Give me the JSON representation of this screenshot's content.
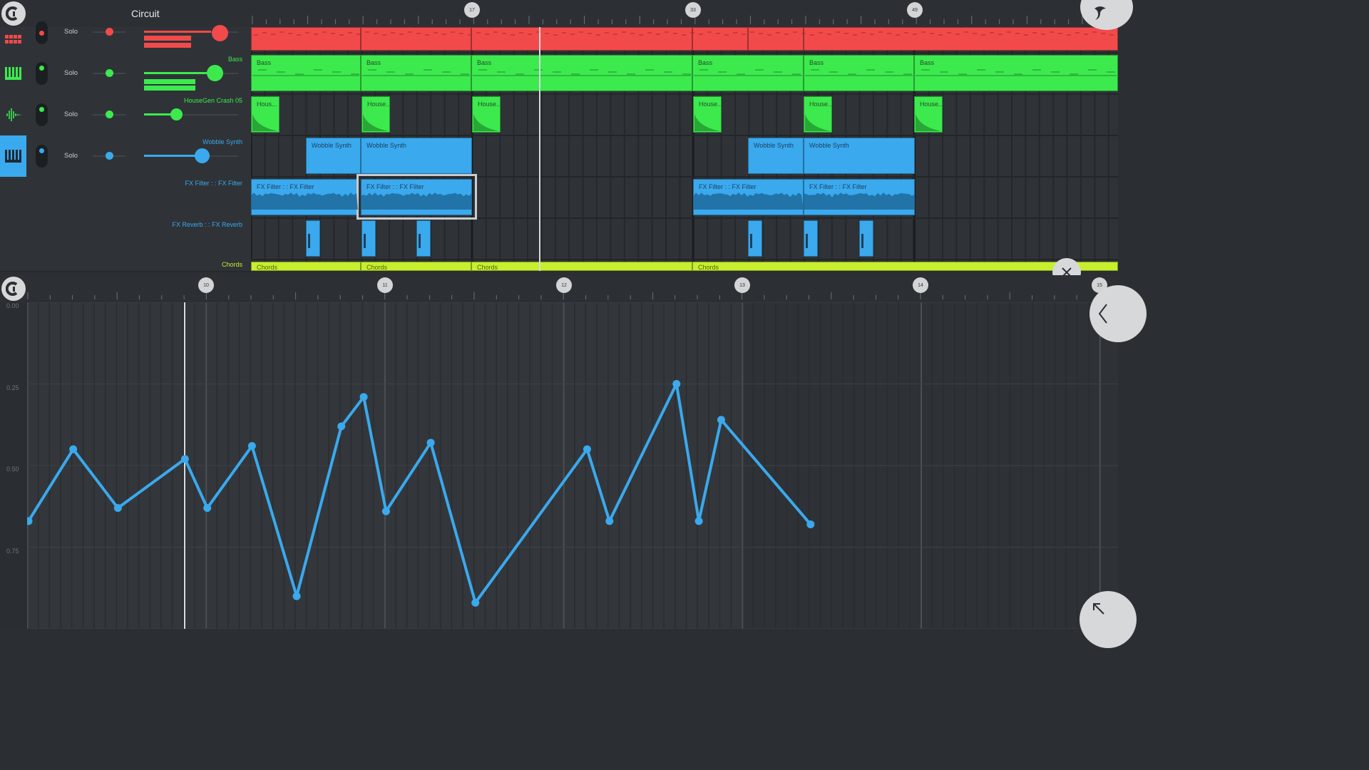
{
  "app": {
    "title": "Circuit"
  },
  "tracks": [
    {
      "name": "",
      "solo": "Solo",
      "color": "#f24a4a"
    },
    {
      "name": "Bass",
      "solo": "Solo",
      "color": "#3cea4e"
    },
    {
      "name": "HouseGen Crash 05",
      "solo": "Solo",
      "color": "#3cea4e"
    },
    {
      "name": "Wobble Synth",
      "solo": "Solo",
      "color": "#3aa9ee"
    },
    {
      "name": "FX Filter : : FX Filter",
      "solo": "",
      "color": "#3aa9ee"
    },
    {
      "name": "FX Reverb : : FX Reverb",
      "solo": "",
      "color": "#3aa9ee"
    },
    {
      "name": "Chords",
      "solo": "",
      "color": "#c7ef2e"
    }
  ],
  "arrangement": {
    "bar_markers": [
      "17",
      "33",
      "49"
    ],
    "clip_labels": {
      "bass": "Bass",
      "house": "House...",
      "house_short": "Hous...",
      "wobble": "Wobble Synth",
      "filter": "FX Filter : : FX Filter",
      "chords": "Chords"
    }
  },
  "automation": {
    "bar_markers": [
      "10",
      "11",
      "12",
      "13",
      "14",
      "15"
    ],
    "y_labels": [
      "0.00",
      "0.25",
      "0.50",
      "0.75"
    ],
    "line_color": "#3aa9ee",
    "points": [
      [
        0.0,
        0.67
      ],
      [
        0.25,
        0.45
      ],
      [
        0.5,
        0.63
      ],
      [
        0.875,
        0.48
      ],
      [
        1.0,
        0.63
      ],
      [
        1.25,
        0.44
      ],
      [
        1.5,
        0.9
      ],
      [
        1.75,
        0.38
      ],
      [
        1.875,
        0.29
      ],
      [
        2.0,
        0.64
      ],
      [
        2.25,
        0.43
      ],
      [
        2.5,
        0.92
      ],
      [
        3.125,
        0.45
      ],
      [
        3.25,
        0.67
      ],
      [
        3.625,
        0.25
      ],
      [
        3.75,
        0.67
      ],
      [
        3.875,
        0.36
      ],
      [
        4.375,
        0.68
      ]
    ]
  },
  "colors": {
    "red": "#f24a4a",
    "green": "#3cea4e",
    "blue": "#3aa9ee",
    "lime": "#c7ef2e"
  }
}
